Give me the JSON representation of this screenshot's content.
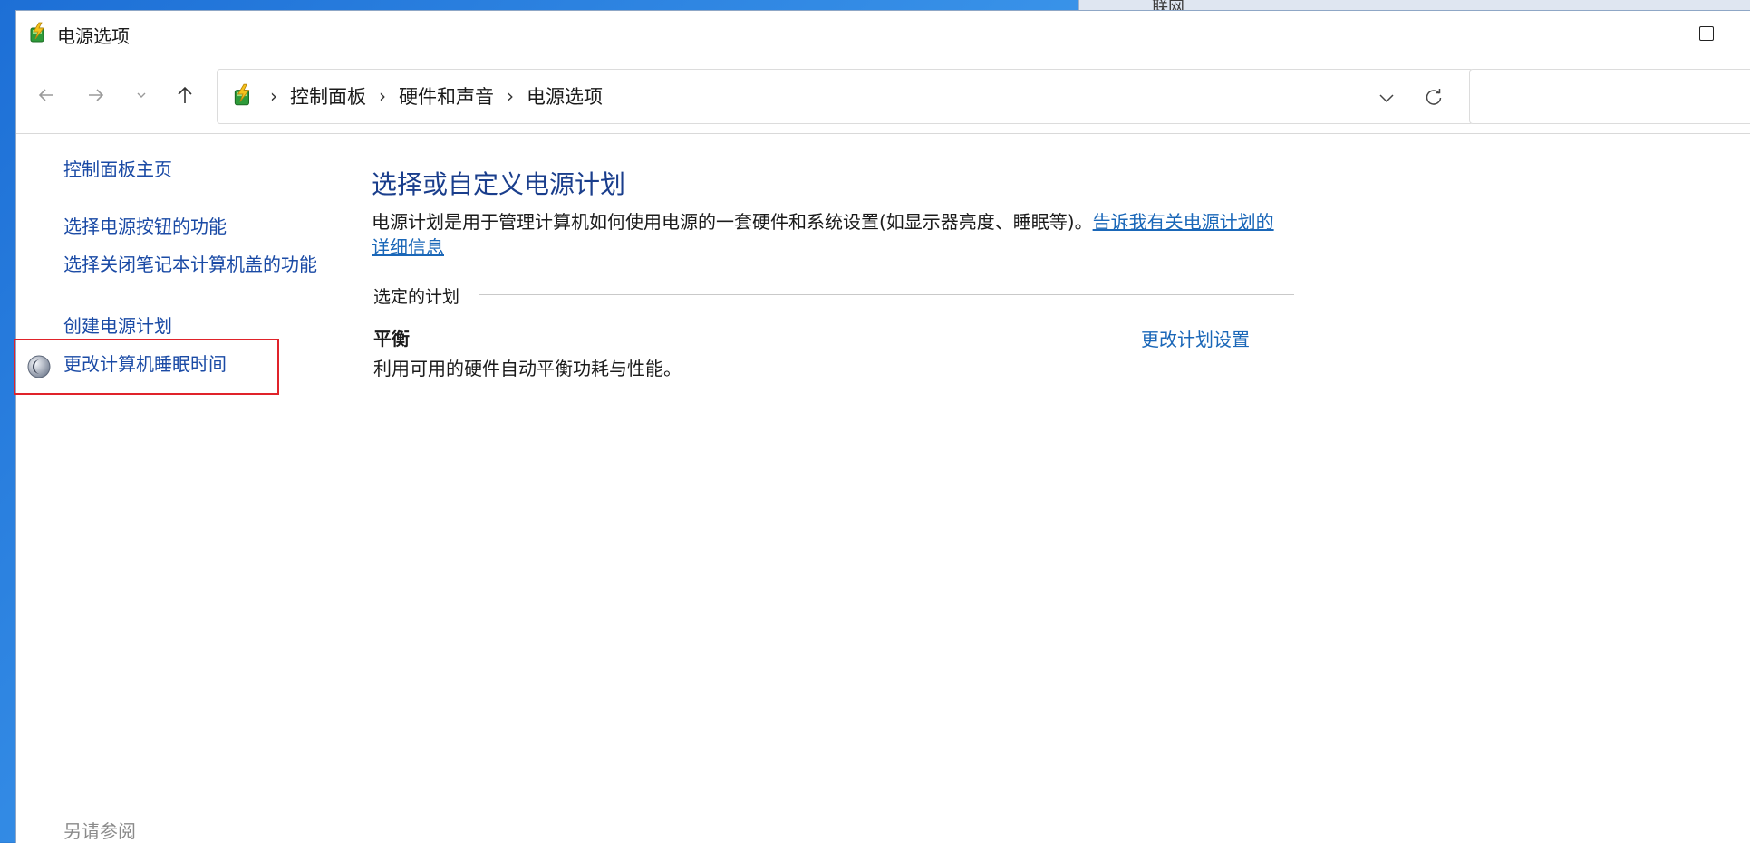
{
  "background": {
    "partial_window_text": "联网"
  },
  "window": {
    "title": "电源选项"
  },
  "address_bar": {
    "crumbs": [
      "控制面板",
      "硬件和声音",
      "电源选项"
    ],
    "separator": "›"
  },
  "left_pane": {
    "home": "控制面板主页",
    "links": [
      "选择电源按钮的功能",
      "选择关闭笔记本计算机盖的功能",
      "创建电源计划",
      "更改计算机睡眠时间"
    ],
    "see_also": "另请参阅"
  },
  "main": {
    "title": "选择或自定义电源计划",
    "description": "电源计划是用于管理计算机如何使用电源的一套硬件和系统设置(如显示器亮度、睡眠等)。",
    "description_link": "告诉我有关电源计划的详细信息",
    "selected_plan_label": "选定的计划",
    "plan": {
      "name": "平衡",
      "description": "利用可用的硬件自动平衡功耗与性能。",
      "change_link": "更改计划设置"
    }
  },
  "colors": {
    "link": "#1a4aa5",
    "title": "#1a3e8c",
    "highlight": "#e0232a"
  }
}
